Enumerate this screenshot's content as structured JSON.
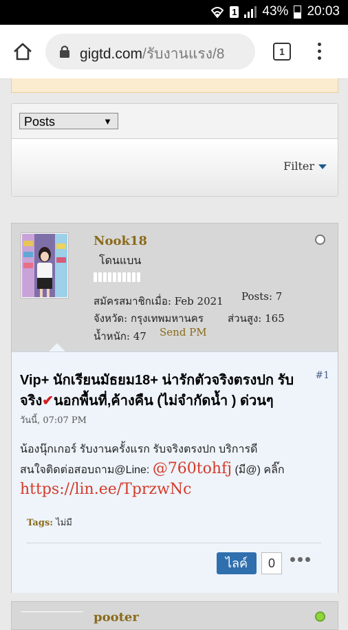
{
  "status_bar": {
    "battery": "43%",
    "time": "20:03",
    "sim": "1"
  },
  "browser": {
    "url_host": "gigtd.com",
    "url_path": "/รับงานแรง/8",
    "tab_count": "1"
  },
  "filter": {
    "select_value": "Posts",
    "filter_label": "Filter"
  },
  "post": {
    "username": "Nook18",
    "user_title": "โดนแบน",
    "joined_label": "สมัครสมาชิกเมื่อ: Feb 2021",
    "posts_label": "Posts: 7",
    "province_label": "จังหวัด: กรุงเทพมหานคร",
    "height_label": "ส่วนสูง: 165",
    "weight_label": "น้ำหนัก: 47",
    "send_pm": "Send PM",
    "title_part1": "Vip+ นักเรียนมัธยม18+ น่ารักตัวจริงตรงปก รับจริง",
    "title_check": "✔",
    "title_part2": "นอกพื้นที่,ค้างคืน (ไม่จำกัดน้ำ ) ด่วนๆ",
    "post_number": "#1",
    "date": "วันนี้, 07:07 PM",
    "message_line1": "น้องนุ๊กเกอร์ รับงานครั้งแรก รับจริงตรงปก บริการดี",
    "message_line2_prefix": "สนใจติดต่อสอบถาม@Line: ",
    "line_id": "@760tohfj",
    "message_line2_suffix": " (มี@) คลิ๊ก",
    "line_url": "https://lin.ee/TprzwNc",
    "tags_label": "Tags:",
    "tags_value": " ไม่มี",
    "like_label": "ไลค์",
    "like_count": "0"
  },
  "next_post": {
    "username": "pooter"
  },
  "colors": {
    "username": "#8a6a1a",
    "link_red": "#d43a2a",
    "like_button": "#2f6fae",
    "post_bg": "#eef4fa",
    "online_green": "#8fd63b"
  },
  "icons": [
    "wifi-icon",
    "signal-icon",
    "battery-icon",
    "home-icon",
    "lock-icon",
    "tabs-icon",
    "menu-icon",
    "dropdown-arrow-icon",
    "filter-arrow-icon",
    "offline-status-icon",
    "more-options-icon",
    "online-status-icon"
  ]
}
